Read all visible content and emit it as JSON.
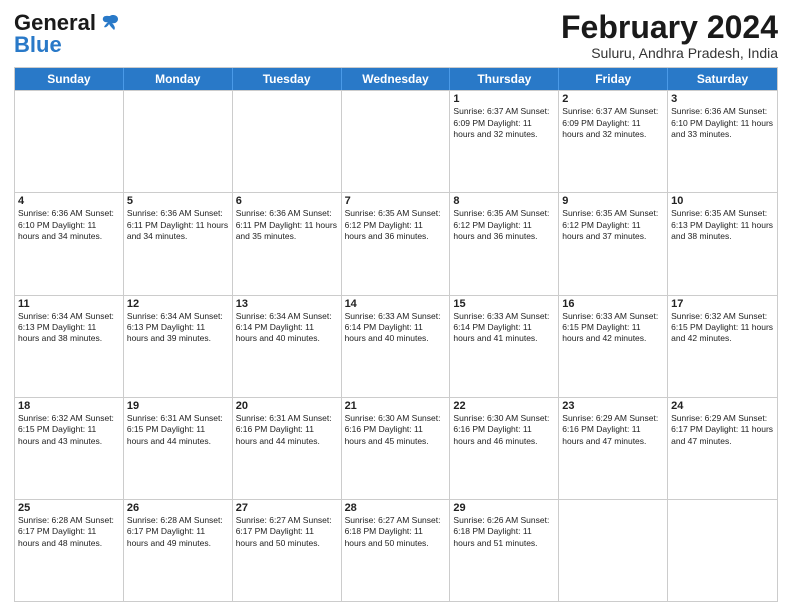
{
  "logo": {
    "general": "General",
    "blue": "Blue"
  },
  "title": {
    "month_year": "February 2024",
    "location": "Suluru, Andhra Pradesh, India"
  },
  "days_of_week": [
    "Sunday",
    "Monday",
    "Tuesday",
    "Wednesday",
    "Thursday",
    "Friday",
    "Saturday"
  ],
  "weeks": [
    [
      {
        "day": "",
        "info": ""
      },
      {
        "day": "",
        "info": ""
      },
      {
        "day": "",
        "info": ""
      },
      {
        "day": "",
        "info": ""
      },
      {
        "day": "1",
        "info": "Sunrise: 6:37 AM\nSunset: 6:09 PM\nDaylight: 11 hours and 32 minutes."
      },
      {
        "day": "2",
        "info": "Sunrise: 6:37 AM\nSunset: 6:09 PM\nDaylight: 11 hours and 32 minutes."
      },
      {
        "day": "3",
        "info": "Sunrise: 6:36 AM\nSunset: 6:10 PM\nDaylight: 11 hours and 33 minutes."
      }
    ],
    [
      {
        "day": "4",
        "info": "Sunrise: 6:36 AM\nSunset: 6:10 PM\nDaylight: 11 hours and 34 minutes."
      },
      {
        "day": "5",
        "info": "Sunrise: 6:36 AM\nSunset: 6:11 PM\nDaylight: 11 hours and 34 minutes."
      },
      {
        "day": "6",
        "info": "Sunrise: 6:36 AM\nSunset: 6:11 PM\nDaylight: 11 hours and 35 minutes."
      },
      {
        "day": "7",
        "info": "Sunrise: 6:35 AM\nSunset: 6:12 PM\nDaylight: 11 hours and 36 minutes."
      },
      {
        "day": "8",
        "info": "Sunrise: 6:35 AM\nSunset: 6:12 PM\nDaylight: 11 hours and 36 minutes."
      },
      {
        "day": "9",
        "info": "Sunrise: 6:35 AM\nSunset: 6:12 PM\nDaylight: 11 hours and 37 minutes."
      },
      {
        "day": "10",
        "info": "Sunrise: 6:35 AM\nSunset: 6:13 PM\nDaylight: 11 hours and 38 minutes."
      }
    ],
    [
      {
        "day": "11",
        "info": "Sunrise: 6:34 AM\nSunset: 6:13 PM\nDaylight: 11 hours and 38 minutes."
      },
      {
        "day": "12",
        "info": "Sunrise: 6:34 AM\nSunset: 6:13 PM\nDaylight: 11 hours and 39 minutes."
      },
      {
        "day": "13",
        "info": "Sunrise: 6:34 AM\nSunset: 6:14 PM\nDaylight: 11 hours and 40 minutes."
      },
      {
        "day": "14",
        "info": "Sunrise: 6:33 AM\nSunset: 6:14 PM\nDaylight: 11 hours and 40 minutes."
      },
      {
        "day": "15",
        "info": "Sunrise: 6:33 AM\nSunset: 6:14 PM\nDaylight: 11 hours and 41 minutes."
      },
      {
        "day": "16",
        "info": "Sunrise: 6:33 AM\nSunset: 6:15 PM\nDaylight: 11 hours and 42 minutes."
      },
      {
        "day": "17",
        "info": "Sunrise: 6:32 AM\nSunset: 6:15 PM\nDaylight: 11 hours and 42 minutes."
      }
    ],
    [
      {
        "day": "18",
        "info": "Sunrise: 6:32 AM\nSunset: 6:15 PM\nDaylight: 11 hours and 43 minutes."
      },
      {
        "day": "19",
        "info": "Sunrise: 6:31 AM\nSunset: 6:15 PM\nDaylight: 11 hours and 44 minutes."
      },
      {
        "day": "20",
        "info": "Sunrise: 6:31 AM\nSunset: 6:16 PM\nDaylight: 11 hours and 44 minutes."
      },
      {
        "day": "21",
        "info": "Sunrise: 6:30 AM\nSunset: 6:16 PM\nDaylight: 11 hours and 45 minutes."
      },
      {
        "day": "22",
        "info": "Sunrise: 6:30 AM\nSunset: 6:16 PM\nDaylight: 11 hours and 46 minutes."
      },
      {
        "day": "23",
        "info": "Sunrise: 6:29 AM\nSunset: 6:16 PM\nDaylight: 11 hours and 47 minutes."
      },
      {
        "day": "24",
        "info": "Sunrise: 6:29 AM\nSunset: 6:17 PM\nDaylight: 11 hours and 47 minutes."
      }
    ],
    [
      {
        "day": "25",
        "info": "Sunrise: 6:28 AM\nSunset: 6:17 PM\nDaylight: 11 hours and 48 minutes."
      },
      {
        "day": "26",
        "info": "Sunrise: 6:28 AM\nSunset: 6:17 PM\nDaylight: 11 hours and 49 minutes."
      },
      {
        "day": "27",
        "info": "Sunrise: 6:27 AM\nSunset: 6:17 PM\nDaylight: 11 hours and 50 minutes."
      },
      {
        "day": "28",
        "info": "Sunrise: 6:27 AM\nSunset: 6:18 PM\nDaylight: 11 hours and 50 minutes."
      },
      {
        "day": "29",
        "info": "Sunrise: 6:26 AM\nSunset: 6:18 PM\nDaylight: 11 hours and 51 minutes."
      },
      {
        "day": "",
        "info": ""
      },
      {
        "day": "",
        "info": ""
      }
    ]
  ]
}
